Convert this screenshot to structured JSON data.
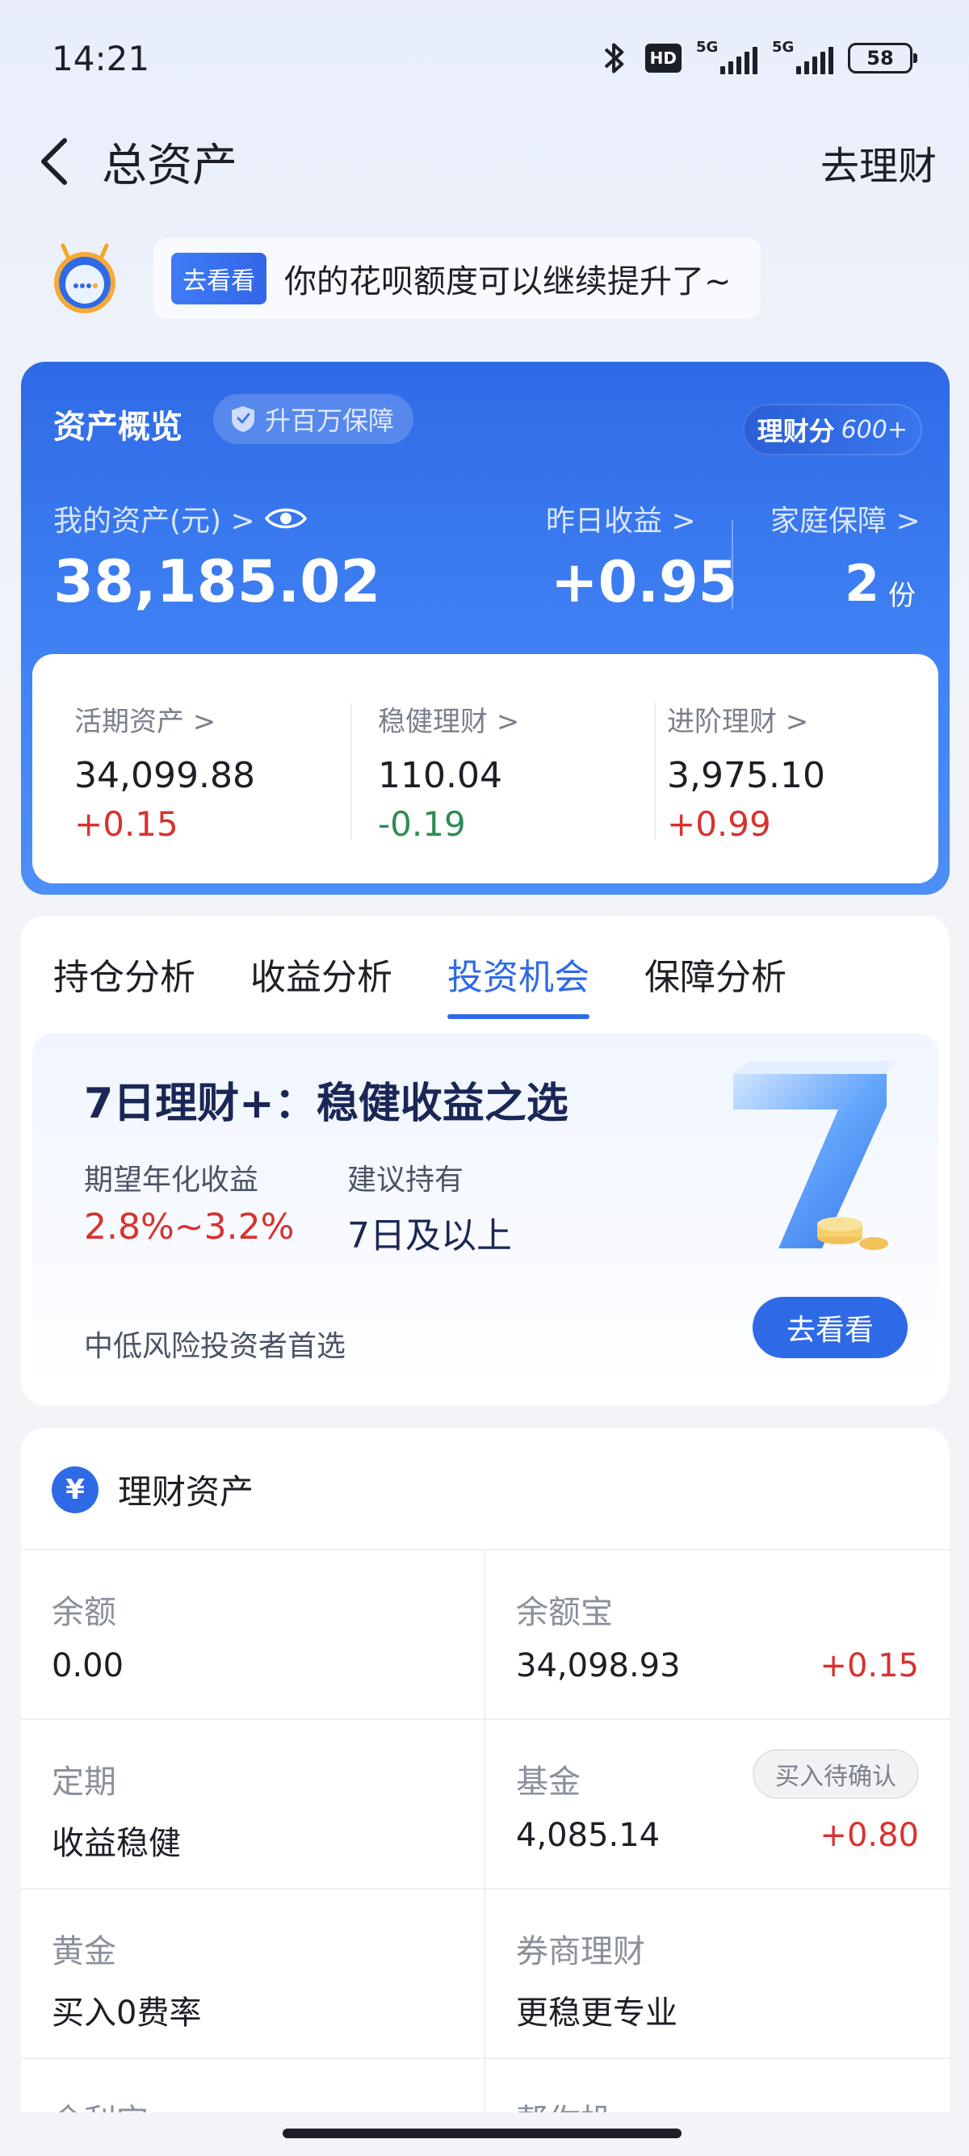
{
  "status_bar": {
    "time": "14:21",
    "network1": "5G",
    "network2": "5G",
    "hd": "HD",
    "battery": "58"
  },
  "header": {
    "title": "总资产",
    "right_action": "去理财"
  },
  "promo": {
    "tag": "去看看",
    "text": "你的花呗额度可以继续提升了~"
  },
  "overview": {
    "title": "资产概览",
    "badge": "升百万保障",
    "score_label": "理财分",
    "score_value": "600+",
    "my_assets_label": "我的资产(元) >",
    "my_assets_value": "38,185.02",
    "yesterday_label": "昨日收益 >",
    "yesterday_value": "+0.95",
    "family_label": "家庭保障 >",
    "family_value": "2",
    "family_unit": "份",
    "breakdown": [
      {
        "label": "活期资产 >",
        "value": "34,099.88",
        "delta": "+0.15"
      },
      {
        "label": "稳健理财 >",
        "value": "110.04",
        "delta": "-0.19"
      },
      {
        "label": "进阶理财 >",
        "value": "3,975.10",
        "delta": "+0.99"
      }
    ]
  },
  "analysis": {
    "tabs": [
      "持仓分析",
      "收益分析",
      "投资机会",
      "保障分析"
    ],
    "active_tab": "投资机会",
    "opportunity": {
      "title": "7日理财+：稳健收益之选",
      "col1_label": "期望年化收益",
      "col1_value": "2.8%~3.2%",
      "col2_label": "建议持有",
      "col2_value": "7日及以上",
      "note": "中低风险投资者首选",
      "cta": "去看看"
    }
  },
  "wealth": {
    "icon": "¥",
    "title": "理财资产",
    "items": [
      {
        "label": "余额",
        "value": "0.00"
      },
      {
        "label": "余额宝",
        "value": "34,098.93",
        "delta": "+0.15"
      },
      {
        "label": "定期",
        "value": "收益稳健"
      },
      {
        "label": "基金",
        "value": "4,085.14",
        "delta": "+0.80",
        "badge": "买入待确认"
      },
      {
        "label": "黄金",
        "value": "买入0费率"
      },
      {
        "label": "券商理财",
        "value": "更稳更专业"
      },
      {
        "label": "余利宝",
        "value": ""
      },
      {
        "label": "帮你投",
        "value": ""
      }
    ]
  },
  "colors": {
    "brand_blue": "#2f6ae6",
    "positive_red": "#d8322f",
    "negative_green": "#2e8b57"
  }
}
